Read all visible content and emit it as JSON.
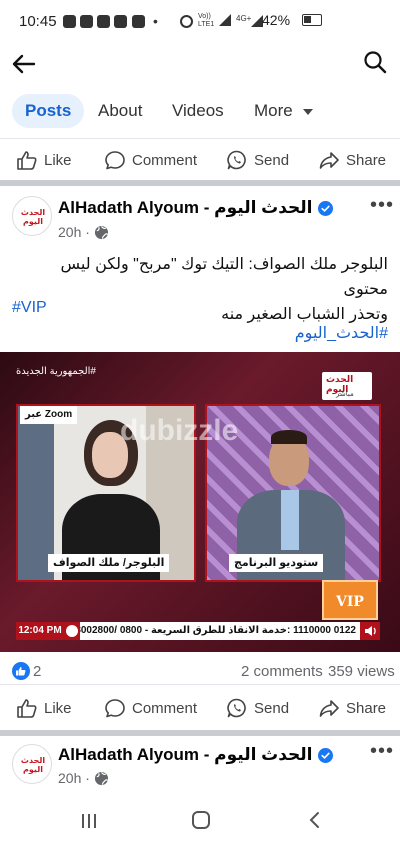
{
  "status_bar": {
    "time": "10:45",
    "battery": "42%",
    "network": "4G+",
    "volte": "Vo)) LTE1"
  },
  "tabs": [
    {
      "label": "Posts"
    },
    {
      "label": "About"
    },
    {
      "label": "Videos"
    },
    {
      "label": "More"
    }
  ],
  "actions": {
    "like": "Like",
    "comment": "Comment",
    "send": "Send",
    "share": "Share"
  },
  "post1": {
    "page_name": "AlHadath Alyoum - الحدث اليوم",
    "time": "20h ·",
    "avatar_text": "الحدث اليوم",
    "text_line1": "البلوجر ملك الصواف: التيك توك \"مربح\" ولكن ليس محتوى",
    "text_line2": "وتحذر الشباب الصغير منه",
    "tag1": "#VIP",
    "tag2": "#الحدث_اليوم",
    "video": {
      "top_left_label": "#الجمهورية الجديدة",
      "logo": "الحدث اليوم",
      "logo_sub": "مباشر",
      "zoom_label": "Zoom عبر",
      "watermark": "dubizzle",
      "left_caption": "البلوجر/ ملك الصواف",
      "right_caption": "ستوديو البرنامج",
      "vip_badge": "VIP",
      "ticker_time": "12:04 PM",
      "ticker_text": "0122 1110000 :خدمة الانقاذ للطرق السريعة - 0800 /8002800"
    },
    "reactions": {
      "count": "2",
      "comments": "2 comments",
      "views": "359 views"
    }
  },
  "post2": {
    "page_name": "AlHadath Alyoum - الحدث اليوم",
    "time": "20h ·",
    "avatar_text": "الحدث اليوم"
  },
  "colors": {
    "brand_blue": "#1763cf",
    "tab_active_bg": "#e7f0fd",
    "verified_blue": "#1877f2",
    "news_red": "#b0121c"
  }
}
